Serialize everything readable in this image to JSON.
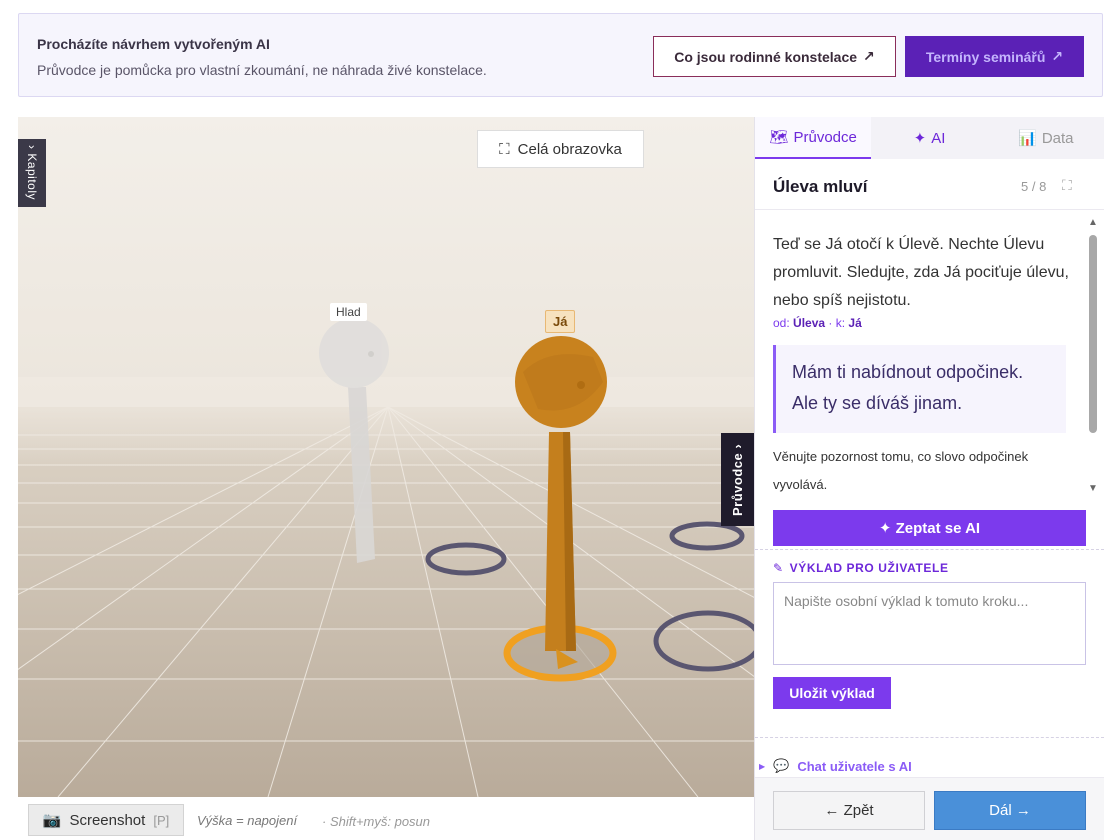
{
  "banner": {
    "title": "Procházíte návrhem vytvořeným AI",
    "subtitle": "Průvodce je pomůcka pro vlastní zkoumání, ne náhrada živé konstelace.",
    "btn_what": "Co jsou rodinné konstelace",
    "btn_terms": "Termíny seminářů",
    "external_glyph": "↗"
  },
  "scene": {
    "chapters_tab": "› Kapitoly",
    "fullscreen_label": "Celá obrazovka",
    "figures": [
      {
        "label": "Hlad"
      },
      {
        "label": "Já"
      }
    ],
    "guide_tab": "Průvodce ›",
    "colors": {
      "active_figure": "#c9831f",
      "ghost_figure": "#d8d6d4",
      "active_ring": "#f0a020",
      "ring": "#5a5670"
    }
  },
  "scenebar": {
    "screenshot_label": "Screenshot",
    "screenshot_key": "[P]",
    "hint_height": "Výška = napojení",
    "hint_pan": "· Shift+myš: posun"
  },
  "panel": {
    "tabs": [
      {
        "label": "Průvodce",
        "icon": "🗺"
      },
      {
        "label": "AI",
        "icon": "✦"
      },
      {
        "label": "Data",
        "icon": "📊"
      }
    ],
    "step_title": "Úleva mluví",
    "step_count": "5 / 8",
    "description": "Teď se Já otočí k Úlevě. Nechte Úlevu promluvit. Sledujte, zda Já pociťuje úlevu, nebo spíš nejistotu.",
    "meta_from_label": "od:",
    "meta_from": "Úleva",
    "meta_sep": " · ",
    "meta_to_label": "k:",
    "meta_to": "Já",
    "quote_line1": "Mám ti nabídnout odpočinek.",
    "quote_line2": "Ale ty se díváš jinam.",
    "note": "Věnujte pozornost tomu, co slovo odpočinek vyvolává.",
    "ask_ai_label": "✦ Zeptat se AI",
    "interpretation_heading": "VÝKLAD PRO UŽIVATELE",
    "interpretation_icon": "✎",
    "interpretation_placeholder": "Napište osobní výklad k tomuto kroku...",
    "save_label": "Uložit výklad",
    "chat_label": "Chat uživatele s AI",
    "chat_icon": "💬",
    "back_label": "← Zpět",
    "next_label": "Dál →",
    "accent": "#7c3aed"
  }
}
